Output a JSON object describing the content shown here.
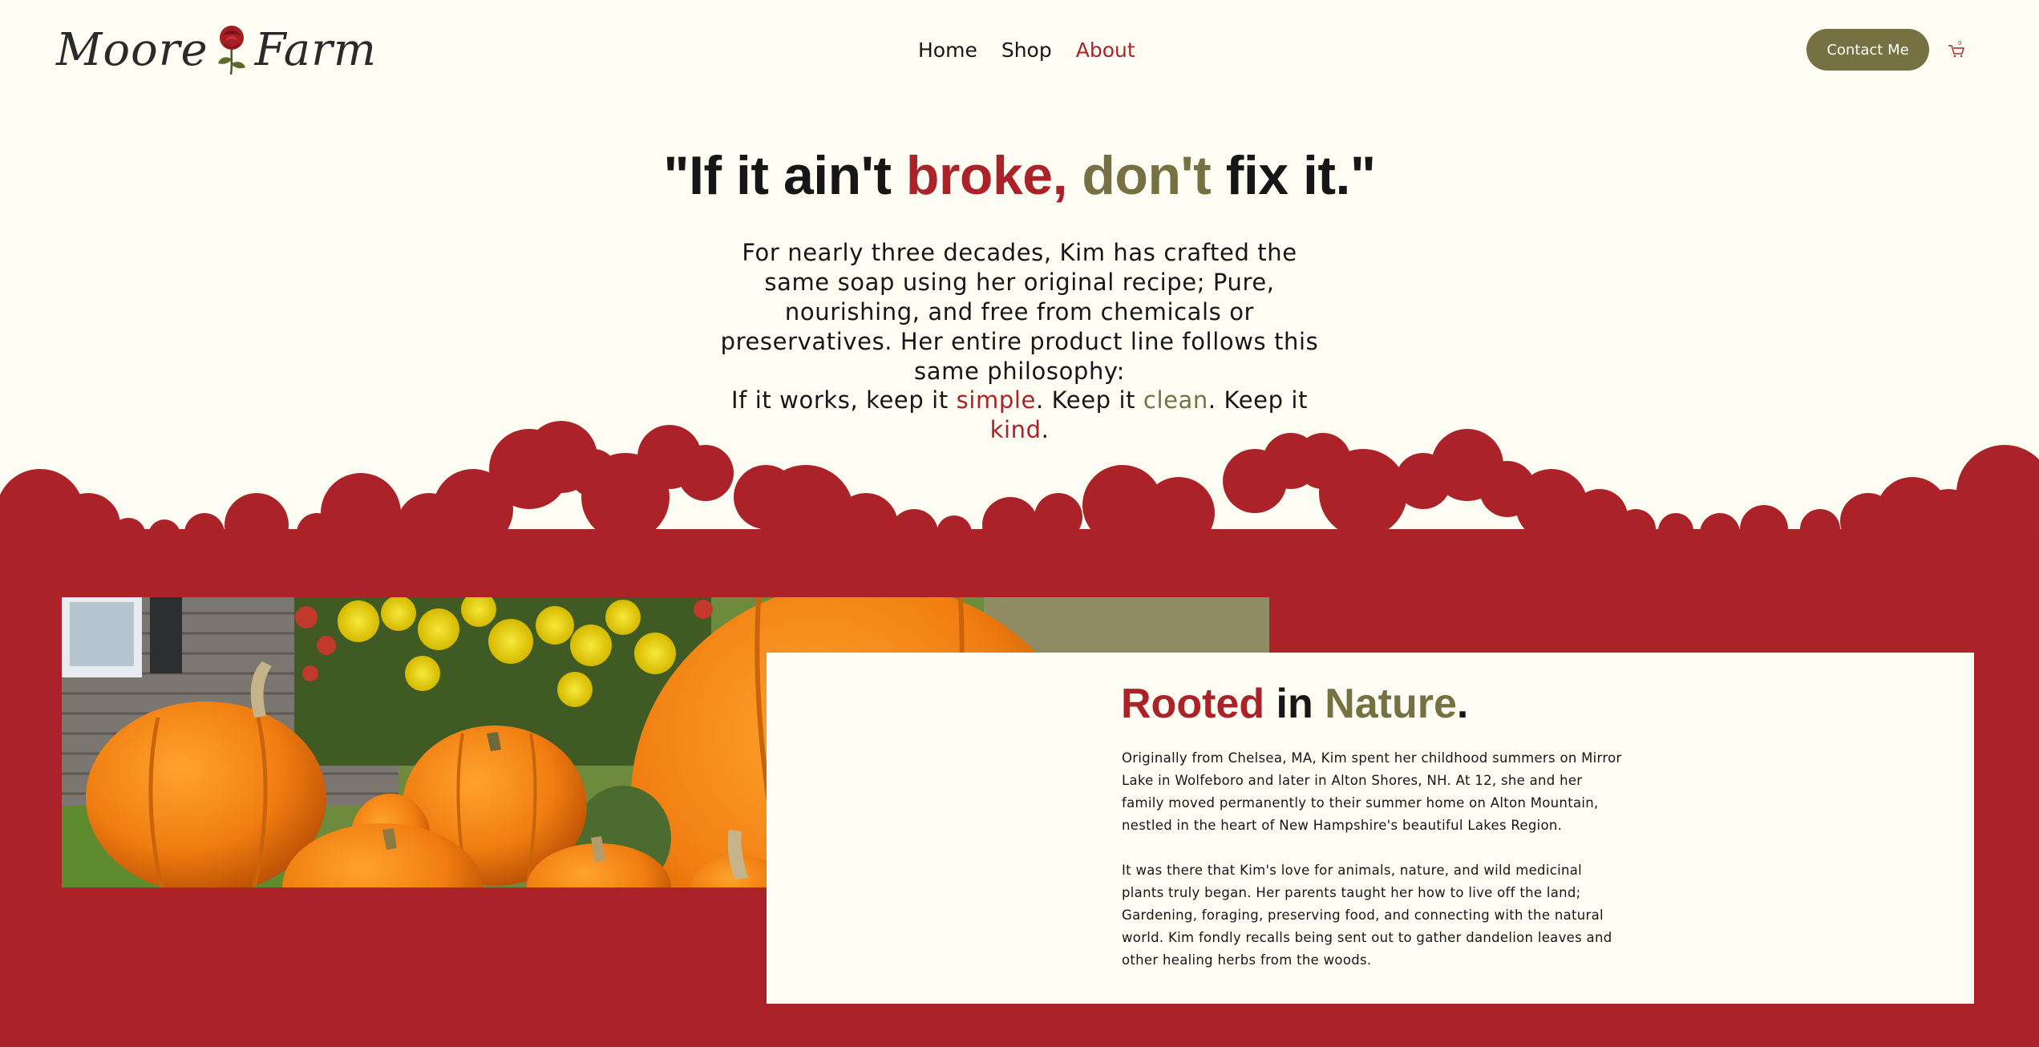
{
  "brand": {
    "logo_text_left": "Moore",
    "logo_text_right": "Farm",
    "logo_icon": "rose-icon"
  },
  "nav": {
    "items": [
      {
        "label": "Home",
        "active": false
      },
      {
        "label": "Shop",
        "active": false
      },
      {
        "label": "About",
        "active": true
      }
    ],
    "contact_label": "Contact Me",
    "cart_icon": "cart-icon",
    "cart_count": "0"
  },
  "hero": {
    "quote_open": "\"If it ain't ",
    "quote_broke": "broke,",
    "quote_dont": "don't",
    "quote_close": " fix it.\"",
    "intro": "For nearly three decades, Kim has crafted the same soap using her original recipe; Pure, nourishing, and free from chemicals or preservatives. Her entire product line follows this same philosophy:",
    "motto_1": "If it works, keep it ",
    "motto_simple": "simple",
    "motto_2": ". Keep it ",
    "motto_clean": "clean",
    "motto_3": ". Keep it ",
    "motto_kind": "kind",
    "motto_4": "."
  },
  "about": {
    "title_rooted": "Rooted",
    "title_in": " in ",
    "title_nature": "Nature",
    "title_period": ".",
    "paragraph_1": "Originally from Chelsea, MA, Kim spent her childhood summers on Mirror Lake in Wolfeboro and later in Alton Shores, NH. At 12, she and her family moved permanently to their summer home on Alton Mountain, nestled in the heart of New Hampshire's beautiful Lakes Region.",
    "paragraph_2": "It was there that Kim's love for animals, nature, and wild medicinal plants truly began. Her parents taught her how to live off the land; Gardening, foraging, preserving food, and connecting with the natural world. Kim fondly recalls being sent out to gather dandelion leaves and other healing herbs from the woods."
  },
  "colors": {
    "background": "#fdfdf3",
    "brand_red": "#ab2329",
    "olive": "#757143",
    "text": "#161616"
  }
}
